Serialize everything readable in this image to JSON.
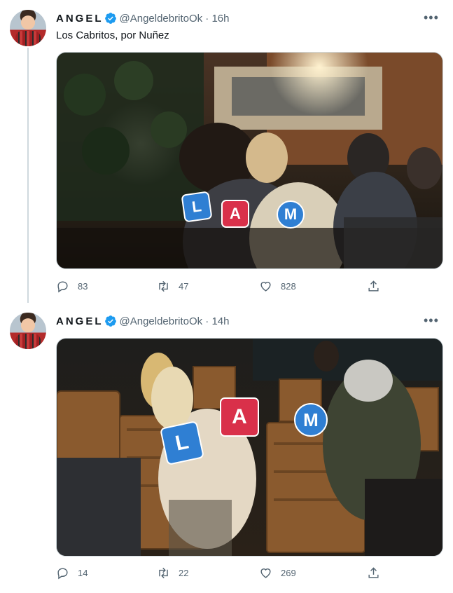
{
  "tweets": [
    {
      "name": "ANGEL",
      "handle": "@AngeldebritoOk",
      "time_sep": " · ",
      "time": "16h",
      "text": "Los Cabritos, por Nuñez",
      "replies": "83",
      "retweets": "47",
      "likes": "828",
      "logo_letters": [
        "L",
        "A",
        "M"
      ]
    },
    {
      "name": "ANGEL",
      "handle": "@AngeldebritoOk",
      "time_sep": " · ",
      "time": "14h",
      "text": "",
      "replies": "14",
      "retweets": "22",
      "likes": "269",
      "logo_letters": [
        "L",
        "A",
        "M"
      ]
    }
  ],
  "icons": {
    "verified": "verified-badge-icon",
    "more": "more-dots-icon",
    "reply": "reply-icon",
    "retweet": "retweet-icon",
    "like": "heart-icon",
    "share": "share-icon"
  },
  "colors": {
    "verified": "#1d9bf0",
    "muted": "#536471",
    "logo_blue": "#2f7fd3",
    "logo_red": "#d9304a"
  }
}
